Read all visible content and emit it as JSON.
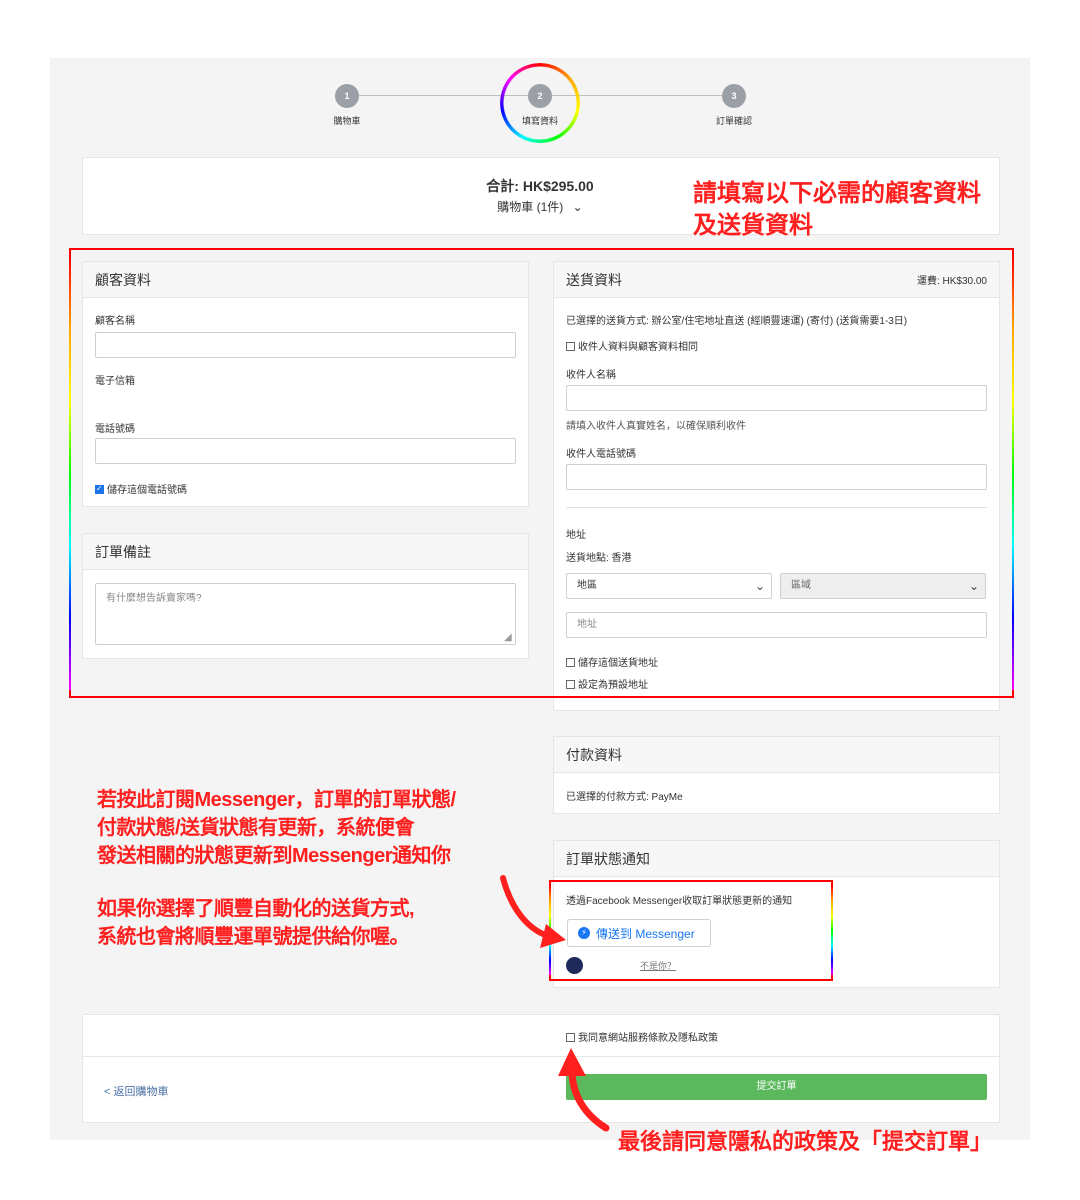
{
  "stepper": {
    "steps": [
      {
        "num": "1",
        "label": "購物車"
      },
      {
        "num": "2",
        "label": "填寫資料"
      },
      {
        "num": "3",
        "label": "訂單確認"
      }
    ]
  },
  "summary": {
    "total": "合計: HK$295.00",
    "cart": "購物車 (1件)",
    "cart_chevron": "⌄"
  },
  "annotations": {
    "fill_required_1": "請填寫以下必需的顧客資料",
    "fill_required_2": "及送貨資料",
    "messenger_1": "若按此訂閱Messenger，訂單的訂單狀態/",
    "messenger_2": "付款狀態/送貨狀態有更新，系統便會",
    "messenger_3": "發送相關的狀態更新到Messenger通知你",
    "sf_1": "如果你選擇了順豐自動化的送貨方式,",
    "sf_2": "系統也會將順豐運單號提供給你喔。",
    "final": "最後請同意隱私的政策及「提交訂單」",
    "accent_color": "#ff1f1f"
  },
  "customer": {
    "title": "顧客資料",
    "name_label": "顧客名稱",
    "name_value": "",
    "email_label": "電子信箱",
    "phone_label": "電話號碼",
    "phone_value": "",
    "save_phone": "儲存這個電話號碼",
    "save_phone_checked": true
  },
  "remarks": {
    "title": "訂單備註",
    "placeholder": "有什麼想告訴賣家嗎?"
  },
  "delivery": {
    "title": "送貨資料",
    "fee": "運費: HK$30.00",
    "method": "已選擇的送貨方式: 辦公室/住宅地址直送 (經順豐速運) (寄付) (送貨需要1-3日)",
    "same_as_customer": "收件人資料與顧客資料相同",
    "recipient_name_label": "收件人名稱",
    "recipient_hint": "請填入收件人真實姓名，以確保順利收件",
    "recipient_phone_label": "收件人電話號碼",
    "address_heading": "地址",
    "delivery_location": "送貨地點: 香港",
    "region_select": "地區",
    "district_select": "區域",
    "address_placeholder": "地址",
    "save_address": "儲存這個送貨地址",
    "set_default": "設定為預設地址"
  },
  "payment": {
    "title": "付款資料",
    "method": "已選擇的付款方式: PayMe"
  },
  "notify": {
    "title": "訂單狀態通知",
    "desc": "透過Facebook Messenger收取訂單狀態更新的通知",
    "button": "傳送到 Messenger",
    "not_you": "不是你？"
  },
  "footer": {
    "agree": "我同意網站服務條款及隱私政策",
    "back": "< 返回購物車",
    "submit": "提交訂單"
  }
}
